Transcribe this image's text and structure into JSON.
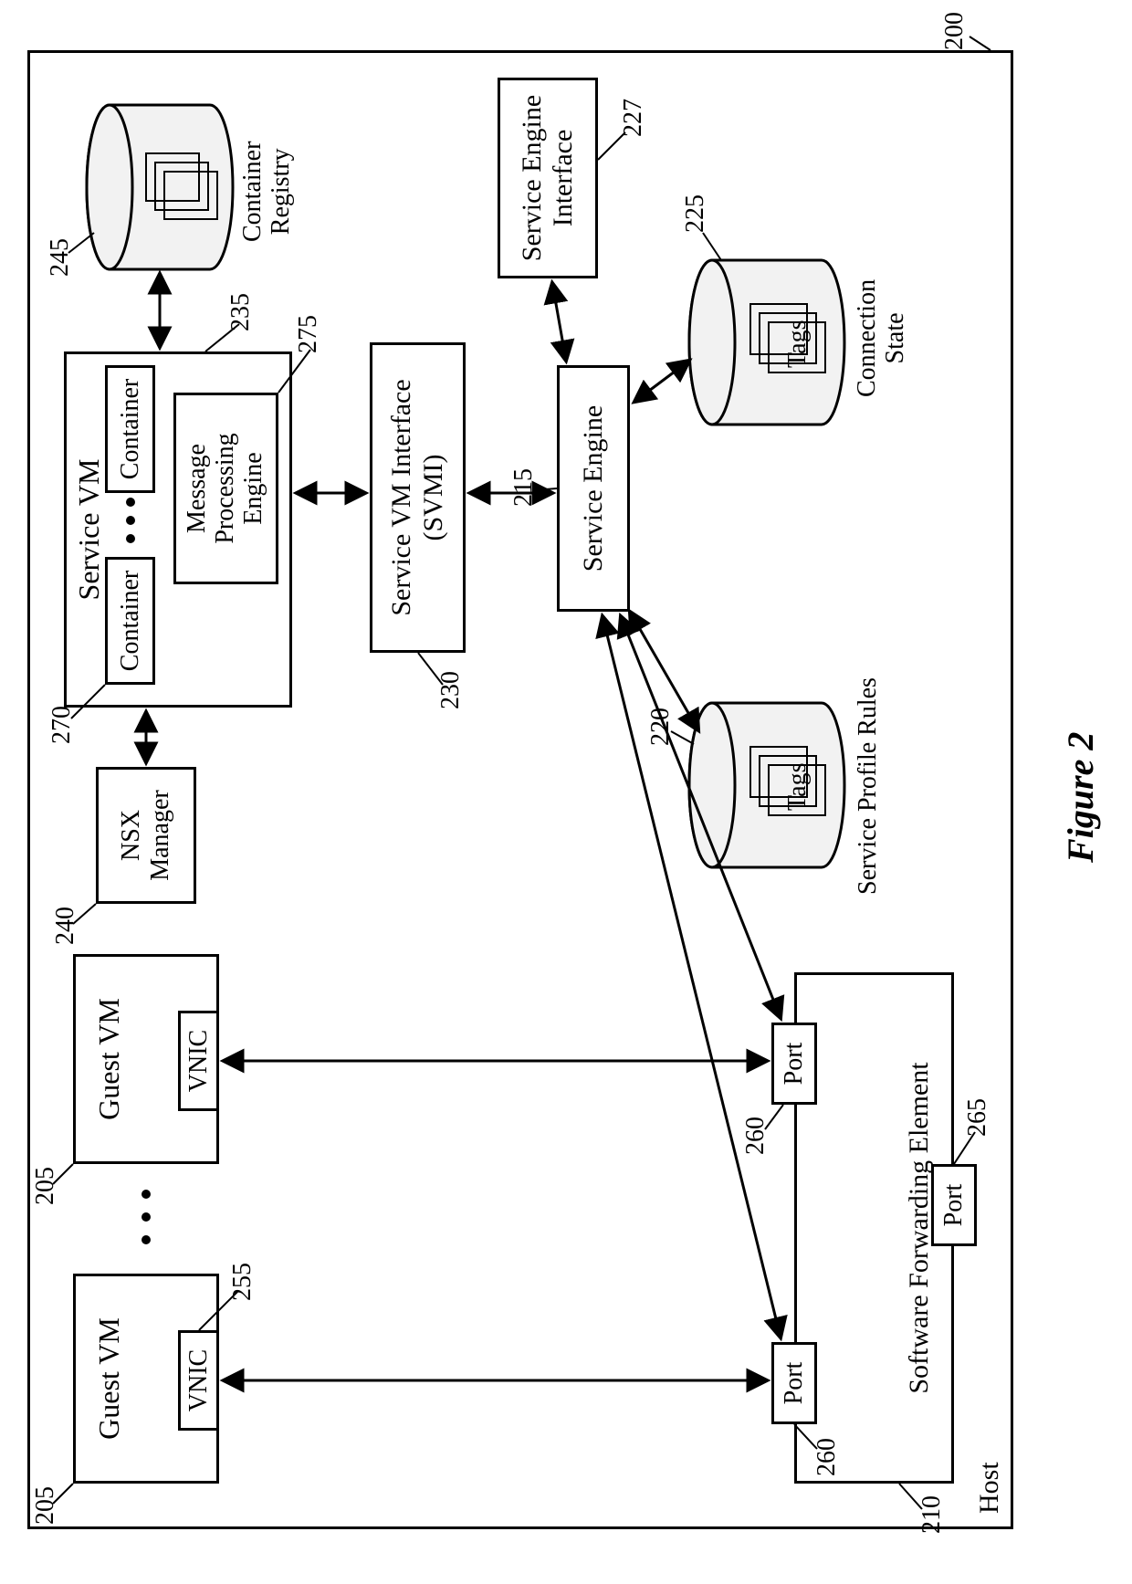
{
  "figure_label": "Figure 2",
  "host": {
    "label": "Host",
    "ref": "200"
  },
  "guest_vm": {
    "title": "Guest VM",
    "vnic": "VNIC",
    "ref": "205",
    "vnic_ref": "255"
  },
  "nsx_manager": {
    "label": "NSX\nManager",
    "ref": "240"
  },
  "service_vm": {
    "title": "Service VM",
    "container": "Container",
    "mpe": "Message\nProcessing\nEngine",
    "ref": "235",
    "container_ref": "270",
    "mpe_ref": "275"
  },
  "container_registry": {
    "label": "Container\nRegistry",
    "ref": "245"
  },
  "svmi": {
    "label": "Service VM Interface\n(SVMI)",
    "ref": "230"
  },
  "service_engine": {
    "label": "Service Engine",
    "ref": "215"
  },
  "sei": {
    "label": "Service Engine\nInterface",
    "ref": "227"
  },
  "spr": {
    "label": "Service Profile Rules",
    "tags": "Tags",
    "ref": "220"
  },
  "conn_state": {
    "label": "Connection\nState",
    "tags": "Tags",
    "ref": "225"
  },
  "sfe": {
    "label": "Software Forwarding Element",
    "port": "Port",
    "ref": "210",
    "port_ref": "260",
    "port_bottom_ref": "265"
  }
}
